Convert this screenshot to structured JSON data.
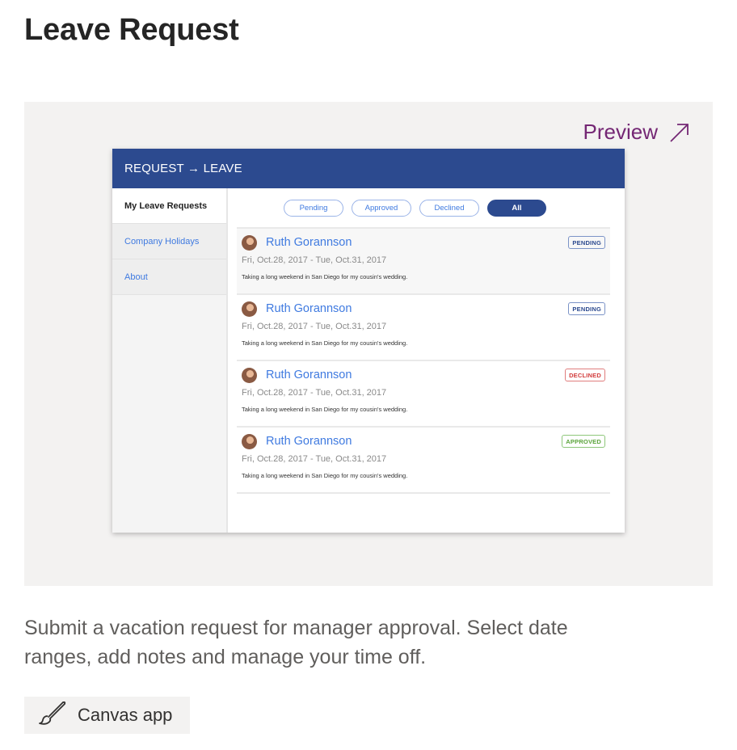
{
  "page": {
    "title": "Leave Request",
    "description": "Submit a vacation request for manager approval. Select date ranges, add notes and manage your time off.",
    "app_type": "Canvas app",
    "app_type_icon": "brush-icon"
  },
  "preview": {
    "label": "Preview",
    "icon": "arrow-up-right-icon",
    "accent_color": "#742774"
  },
  "app": {
    "header_title": "REQUEST → LEAVE",
    "header_color": "#2c4a8f",
    "nav": [
      {
        "label": "My Leave Requests",
        "active": true
      },
      {
        "label": "Company Holidays",
        "active": false
      },
      {
        "label": "About",
        "active": false
      }
    ],
    "filters": [
      {
        "label": "Pending",
        "active": false
      },
      {
        "label": "Approved",
        "active": false
      },
      {
        "label": "Declined",
        "active": false
      },
      {
        "label": "All",
        "active": true
      }
    ],
    "requests": [
      {
        "name": "Ruth Gorannson",
        "dates": "Fri, Oct.28, 2017 - Tue, Oct.31, 2017",
        "note": "Taking a long weekend in San Diego for my cousin's wedding.",
        "status": "PENDING"
      },
      {
        "name": "Ruth Gorannson",
        "dates": "Fri, Oct.28, 2017 - Tue, Oct.31, 2017",
        "note": "Taking a long weekend in San Diego for my cousin's wedding.",
        "status": "PENDING"
      },
      {
        "name": "Ruth Gorannson",
        "dates": "Fri, Oct.28, 2017 - Tue, Oct.31, 2017",
        "note": "Taking a long weekend in San Diego for my cousin's wedding.",
        "status": "DECLINED"
      },
      {
        "name": "Ruth Gorannson",
        "dates": "Fri, Oct.28, 2017 - Tue, Oct.31, 2017",
        "note": "Taking a long weekend in San Diego for my cousin's wedding.",
        "status": "APPROVED"
      }
    ]
  }
}
